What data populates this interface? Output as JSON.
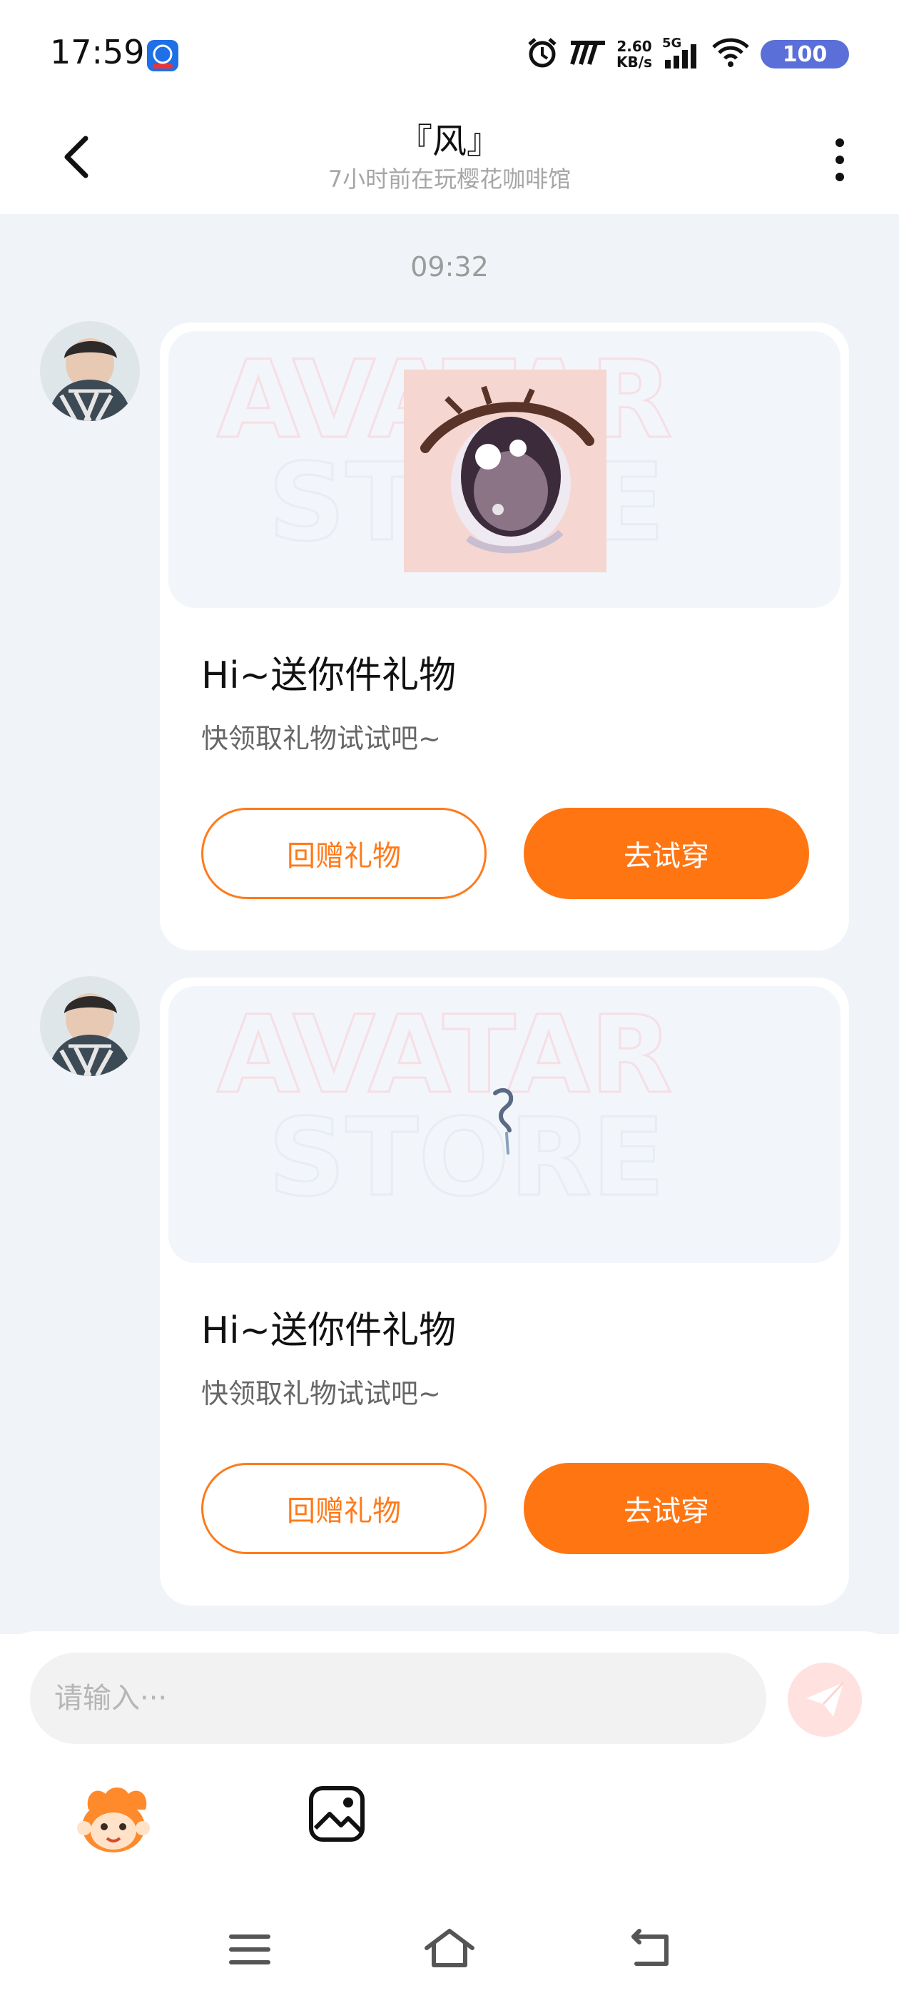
{
  "status_bar": {
    "time": "17:59",
    "net_speed_value": "2.60",
    "net_speed_unit": "KB/s",
    "signal": "5G",
    "battery": "100"
  },
  "header": {
    "title": "『风』",
    "subtitle": "7小时前在玩樱花咖啡馆"
  },
  "chat": {
    "timestamp": "09:32",
    "messages": [
      {
        "title": "Hi~送你件礼物",
        "subtitle": "快领取礼物试试吧~",
        "return_label": "回赠礼物",
        "try_label": "去试穿",
        "watermark": [
          "AVATAR",
          "STORE"
        ]
      },
      {
        "title": "Hi~送你件礼物",
        "subtitle": "快领取礼物试试吧~",
        "return_label": "回赠礼物",
        "try_label": "去试穿",
        "watermark": [
          "AVATAR",
          "STORE"
        ]
      }
    ]
  },
  "input": {
    "placeholder": "请输入···"
  },
  "colors": {
    "accent": "#ff7512",
    "chat_bg": "#f0f4f8",
    "battery": "#5a6fd8"
  },
  "icons": {
    "back": "chevron-left-icon",
    "more": "more-vertical-icon",
    "send": "send-icon",
    "sticker": "sticker-icon",
    "image": "image-icon",
    "nav_menu": "menu-icon",
    "nav_home": "home-icon",
    "nav_back": "back-icon"
  }
}
